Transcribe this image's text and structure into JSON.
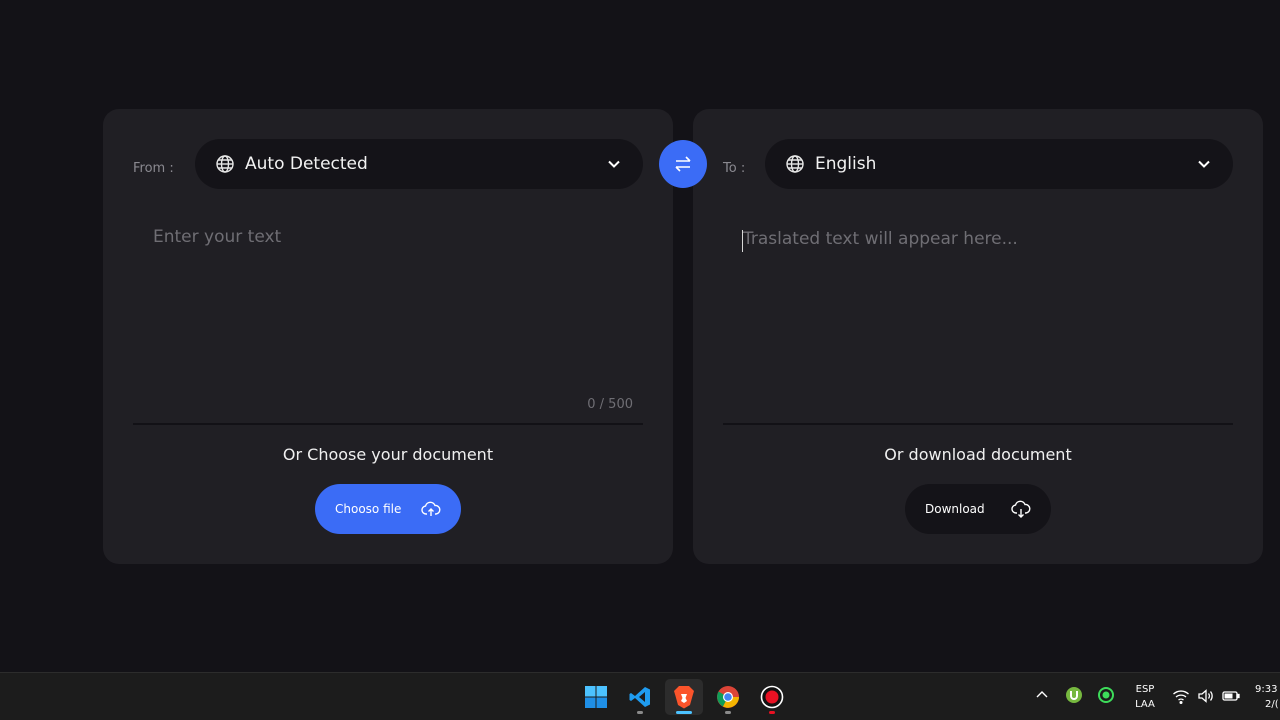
{
  "source": {
    "label": "From :",
    "language": "Auto Detected",
    "placeholder": "Enter your text",
    "counter": "0 / 500",
    "doc_title": "Or Choose your document",
    "button_label": "Chooso file"
  },
  "swap": {
    "icon": "swap-arrows-icon"
  },
  "target": {
    "label": "To :",
    "language": "English",
    "placeholder": "Traslated text will appear here...",
    "doc_title": "Or download document",
    "button_label": "Download"
  },
  "taskbar": {
    "apps": [
      "start-icon",
      "vscode-icon",
      "brave-icon",
      "chrome-icon",
      "record-icon"
    ],
    "tray": {
      "lang_top": "ESP",
      "lang_bottom": "LAA",
      "time": "9:33",
      "date": "2/("
    }
  },
  "colors": {
    "accent": "#3b6cf6",
    "panel": "#201f24",
    "background": "#131217"
  }
}
